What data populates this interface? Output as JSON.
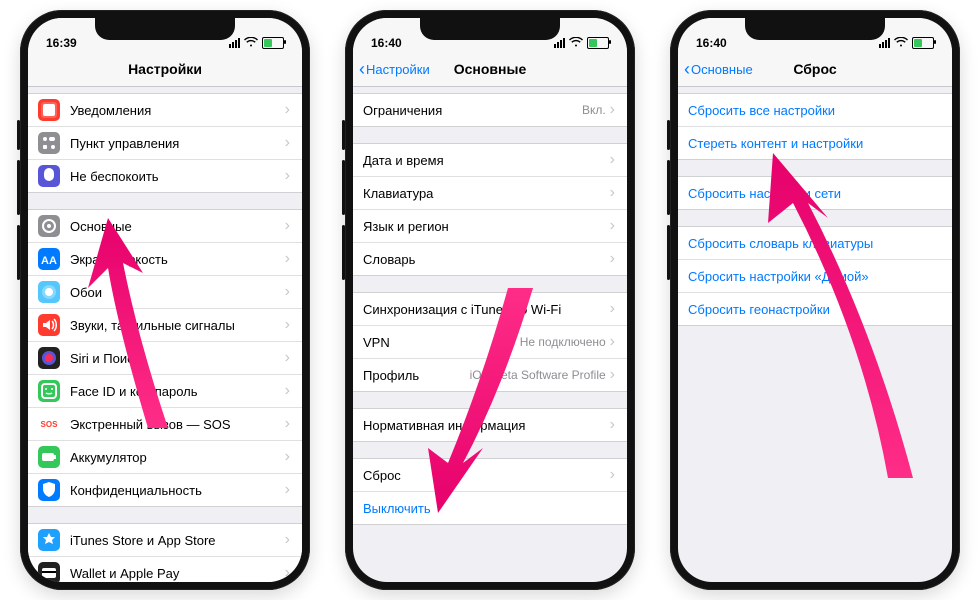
{
  "phone1": {
    "time": "16:39",
    "title": "Настройки",
    "groups": [
      [
        {
          "icon": "notifications",
          "color": "#ff3b30",
          "label": "Уведомления"
        },
        {
          "icon": "control",
          "color": "#8e8e93",
          "label": "Пункт управления"
        },
        {
          "icon": "dnd",
          "color": "#5856d6",
          "label": "Не беспокоить"
        }
      ],
      [
        {
          "icon": "general",
          "color": "#8e8e93",
          "label": "Основные"
        },
        {
          "icon": "display",
          "color": "#007aff",
          "label": "Экран и яркость"
        },
        {
          "icon": "wallpaper",
          "color": "#54c7fc",
          "label": "Обои"
        },
        {
          "icon": "sounds",
          "color": "#ff3b30",
          "label": "Звуки, тактильные сигналы"
        },
        {
          "icon": "siri",
          "color": "#222",
          "label": "Siri и Поиск"
        },
        {
          "icon": "faceid",
          "color": "#34c759",
          "label": "Face ID и код-пароль"
        },
        {
          "icon": "sos",
          "color": "#fff",
          "textcolor": "#ff3b30",
          "label": "Экстренный вызов — SOS",
          "text": "SOS"
        },
        {
          "icon": "battery",
          "color": "#34c759",
          "label": "Аккумулятор"
        },
        {
          "icon": "privacy",
          "color": "#007aff",
          "label": "Конфиденциальность"
        }
      ],
      [
        {
          "icon": "appstore",
          "color": "#1ea0ff",
          "label": "iTunes Store и App Store"
        },
        {
          "icon": "wallet",
          "color": "#222",
          "label": "Wallet и Apple Pay"
        }
      ]
    ]
  },
  "phone2": {
    "time": "16:40",
    "back": "Настройки",
    "title": "Основные",
    "groups": [
      [
        {
          "label": "Ограничения",
          "value": "Вкл."
        }
      ],
      [
        {
          "label": "Дата и время"
        },
        {
          "label": "Клавиатура"
        },
        {
          "label": "Язык и регион"
        },
        {
          "label": "Словарь"
        }
      ],
      [
        {
          "label": "Синхронизация с iTunes по Wi-Fi"
        },
        {
          "label": "VPN",
          "value": "Не подключено"
        },
        {
          "label": "Профиль",
          "value": "iOS Beta Software Profile"
        }
      ],
      [
        {
          "label": "Нормативная информация"
        }
      ],
      [
        {
          "label": "Сброс"
        },
        {
          "label": "Выключить",
          "link": true,
          "nochev": true
        }
      ]
    ]
  },
  "phone3": {
    "time": "16:40",
    "back": "Основные",
    "title": "Сброс",
    "groups": [
      [
        {
          "label": "Сбросить все настройки",
          "link": true,
          "nochev": true
        },
        {
          "label": "Стереть контент и настройки",
          "link": true,
          "nochev": true
        }
      ],
      [
        {
          "label": "Сбросить настройки сети",
          "link": true,
          "nochev": true
        }
      ],
      [
        {
          "label": "Сбросить словарь клавиатуры",
          "link": true,
          "nochev": true
        },
        {
          "label": "Сбросить настройки «Домой»",
          "link": true,
          "nochev": true
        },
        {
          "label": "Сбросить геонастройки",
          "link": true,
          "nochev": true
        }
      ]
    ]
  }
}
